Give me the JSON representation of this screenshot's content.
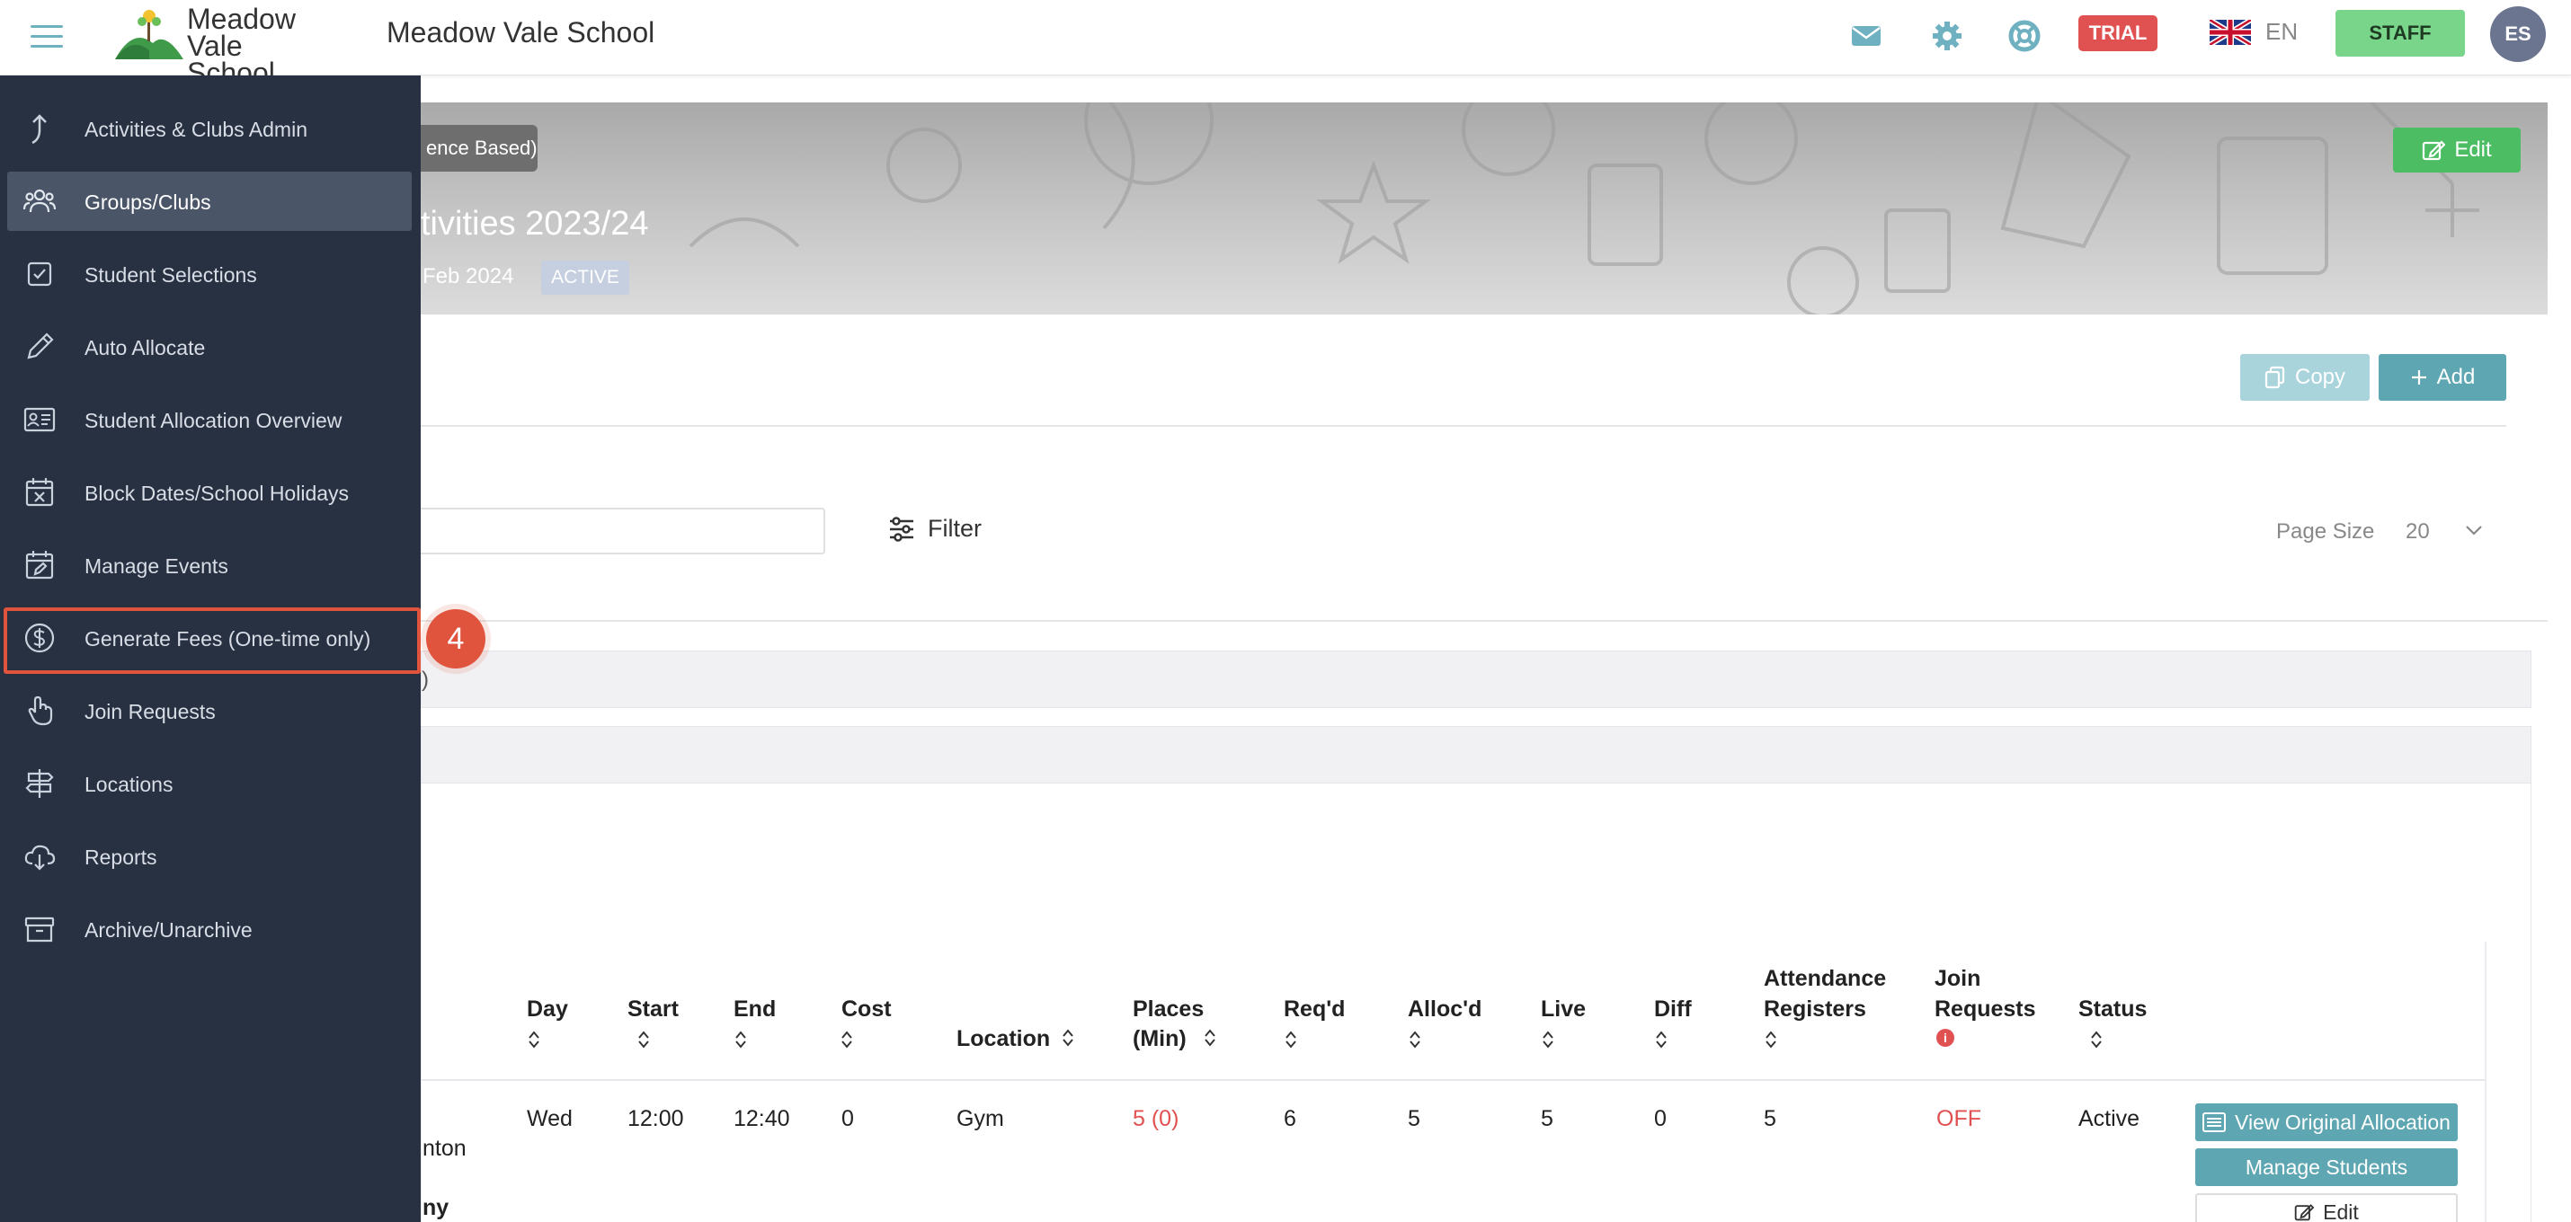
{
  "header": {
    "logo_line1": "Meadow",
    "logo_line2": "Vale School",
    "title": "Meadow Vale School",
    "trial_label": "TRIAL",
    "language": "EN",
    "staff_label": "STAFF",
    "avatar_initials": "ES",
    "accent_color": "#6fb1c0"
  },
  "sidebar": {
    "items": [
      {
        "label": "Activities & Clubs Admin",
        "icon": "arrow-up-icon"
      },
      {
        "label": "Groups/Clubs",
        "icon": "users-icon"
      },
      {
        "label": "Student Selections",
        "icon": "checkbox-icon"
      },
      {
        "label": "Auto Allocate",
        "icon": "pencil-icon"
      },
      {
        "label": "Student Allocation Overview",
        "icon": "id-card-icon"
      },
      {
        "label": "Block Dates/School Holidays",
        "icon": "calendar-x-icon"
      },
      {
        "label": "Manage Events",
        "icon": "calendar-edit-icon"
      },
      {
        "label": "Generate Fees (One-time only)",
        "icon": "dollar-circle-icon"
      },
      {
        "label": "Join Requests",
        "icon": "hand-pointer-icon"
      },
      {
        "label": "Locations",
        "icon": "signpost-icon"
      },
      {
        "label": "Reports",
        "icon": "cloud-download-icon"
      },
      {
        "label": "Archive/Unarchive",
        "icon": "archive-icon"
      }
    ],
    "selected_index": 1,
    "highlight_index": 7,
    "step_number": "4"
  },
  "banner": {
    "chip": "ence Based)",
    "title": "tivities 2023/24",
    "date": "Feb 2024",
    "status": "ACTIVE",
    "edit_label": "Edit"
  },
  "toolbar": {
    "copy_label": "Copy",
    "add_label": "Add",
    "filter_label": "Filter",
    "page_size_label": "Page Size",
    "page_size_value": "20"
  },
  "group_row": {
    "partial_text": ")"
  },
  "table": {
    "headers": {
      "day": "Day",
      "start": "Start",
      "end": "End",
      "cost": "Cost",
      "location": "Location",
      "places_1": "Places",
      "places_2": "(Min)",
      "reqd": "Req'd",
      "allocd": "Alloc'd",
      "live": "Live",
      "diff": "Diff",
      "attendance_1": "Attendance",
      "attendance_2": "Registers",
      "join_1": "Join",
      "join_2": "Requests",
      "status": "Status"
    },
    "row": {
      "name_partial": "nton",
      "name_partial_bold": "ny",
      "day": "Wed",
      "start": "12:00",
      "end": "12:40",
      "cost": "0",
      "location": "Gym",
      "places": "5 (0)",
      "reqd": "6",
      "allocd": "5",
      "live": "5",
      "diff": "0",
      "attendance": "5",
      "join": "OFF",
      "status": "Active"
    },
    "actions": {
      "view_original": "View Original Allocation",
      "manage_students": "Manage Students",
      "edit": "Edit"
    }
  }
}
